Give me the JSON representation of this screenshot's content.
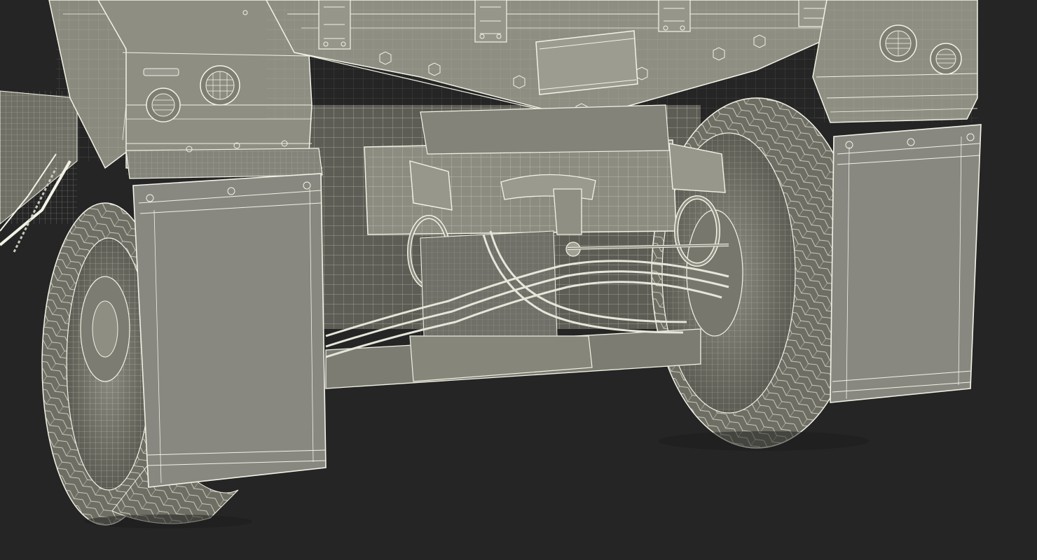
{
  "scene": {
    "subject": "military-vehicle-rear-wireframe",
    "colors": {
      "background": "#252525",
      "body": "#8a8a7e",
      "body_light": "#9a9a8e",
      "body_dark": "#6f6f65",
      "wire": "#f2f2e6",
      "tire": "#7a7a70",
      "shadow": "#3a3a36"
    }
  }
}
